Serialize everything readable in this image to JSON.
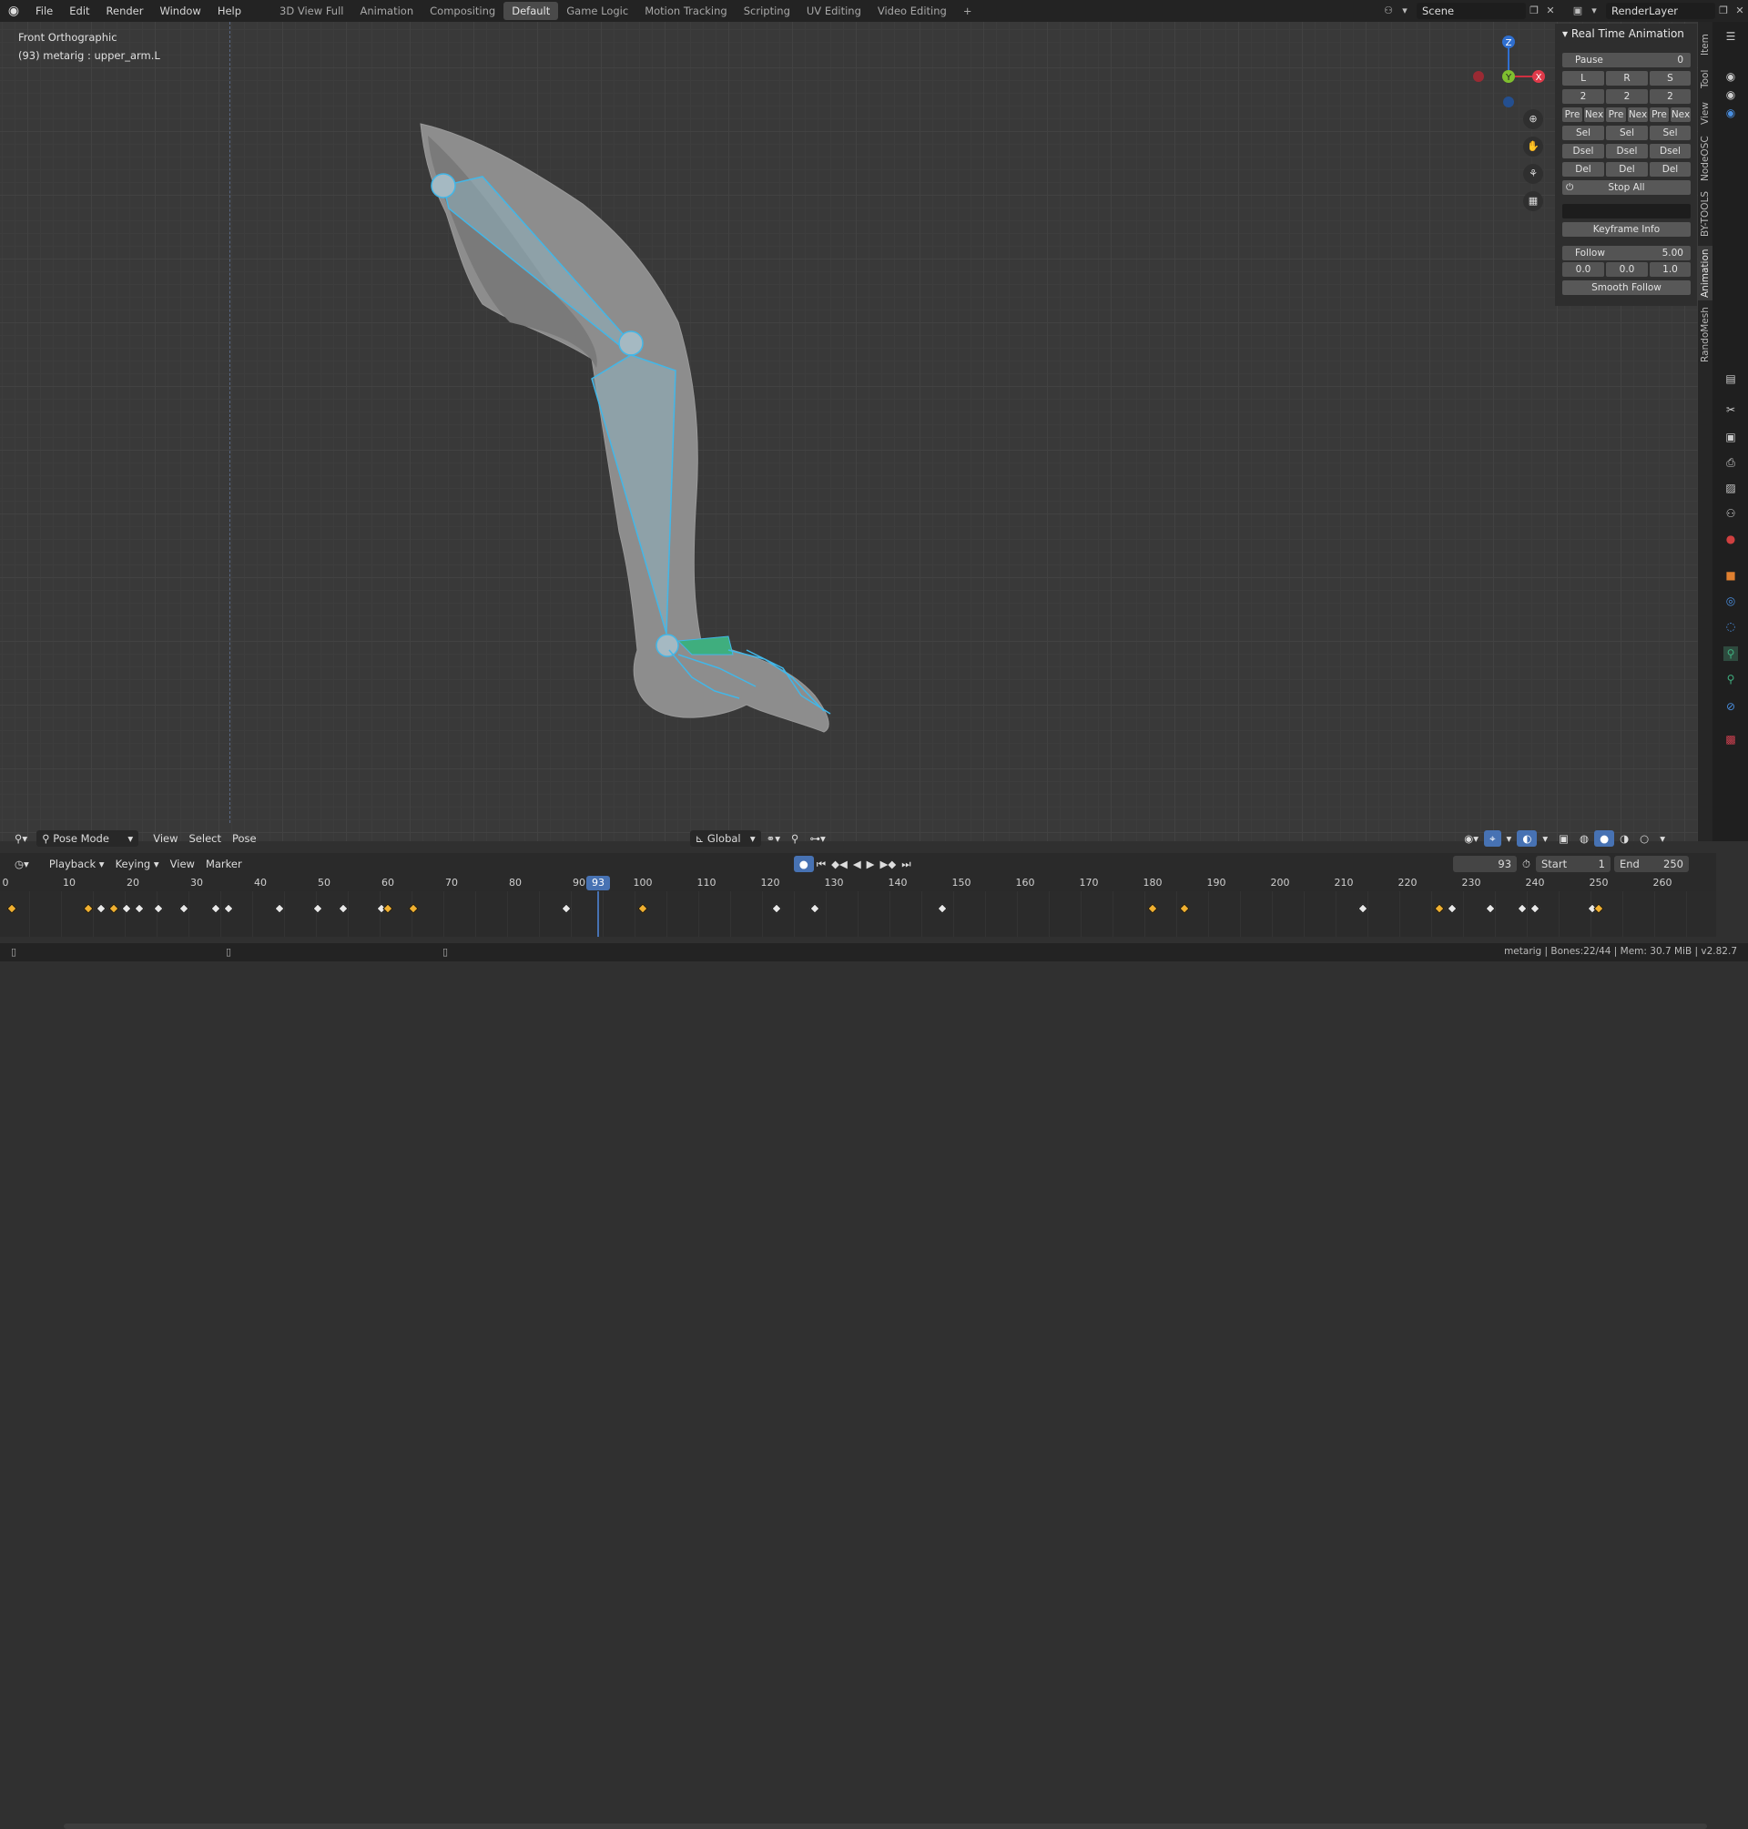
{
  "topbar": {
    "menus": [
      "File",
      "Edit",
      "Render",
      "Window",
      "Help"
    ],
    "workspaces": [
      "3D View Full",
      "Animation",
      "Compositing",
      "Default",
      "Game Logic",
      "Motion Tracking",
      "Scripting",
      "UV Editing",
      "Video Editing"
    ],
    "active_workspace": "Default",
    "add_tab": "+",
    "scene": "Scene",
    "render_layer": "RenderLayer"
  },
  "viewport": {
    "view_name": "Front Orthographic",
    "object_info": "(93) metarig : upper_arm.L",
    "gizmo": {
      "z": "Z",
      "y": "Y",
      "x": "X"
    }
  },
  "npanel": {
    "title": "Real Time Animation",
    "pause_label": "Pause",
    "pause_value": "0",
    "lrs": [
      "L",
      "R",
      "S"
    ],
    "counts": [
      "2",
      "2",
      "2"
    ],
    "prenex": [
      "Pre",
      "Nex",
      "Pre",
      "Nex",
      "Pre",
      "Nex"
    ],
    "sel": [
      "Sel",
      "Sel",
      "Sel"
    ],
    "dsel": [
      "Dsel",
      "Dsel",
      "Dsel"
    ],
    "del": [
      "Del",
      "Del",
      "Del"
    ],
    "stop_all": "Stop All",
    "keyframe_info": "Keyframe Info",
    "follow_label": "Follow",
    "follow_value": "5.00",
    "vec": [
      "0.0",
      "0.0",
      "1.0"
    ],
    "smooth_follow": "Smooth Follow"
  },
  "sidetabs": [
    "Item",
    "Tool",
    "View",
    "NodeOSC",
    "BY-TOOLS",
    "Animation",
    "RandoMesh"
  ],
  "vp_header": {
    "mode": "Pose Mode",
    "menus": [
      "View",
      "Select",
      "Pose"
    ],
    "orientation": "Global"
  },
  "timeline": {
    "menus": [
      "Playback",
      "Keying",
      "View",
      "Marker"
    ],
    "current_frame": "93",
    "start_label": "Start",
    "start_value": "1",
    "end_label": "End",
    "end_value": "250",
    "ticks": [
      "0",
      "10",
      "20",
      "30",
      "40",
      "50",
      "60",
      "70",
      "80",
      "90",
      "100",
      "110",
      "120",
      "130",
      "140",
      "150",
      "160",
      "170",
      "180",
      "190",
      "200",
      "210",
      "220",
      "230",
      "240",
      "250",
      "260"
    ],
    "current_marker": "93",
    "keyframes": [
      {
        "f": 1,
        "c": "yellow"
      },
      {
        "f": 13,
        "c": "yellow"
      },
      {
        "f": 15,
        "c": "white"
      },
      {
        "f": 17,
        "c": "yellow"
      },
      {
        "f": 19,
        "c": "white"
      },
      {
        "f": 21,
        "c": "white"
      },
      {
        "f": 24,
        "c": "white"
      },
      {
        "f": 28,
        "c": "white"
      },
      {
        "f": 33,
        "c": "white"
      },
      {
        "f": 35,
        "c": "white"
      },
      {
        "f": 43,
        "c": "white"
      },
      {
        "f": 49,
        "c": "white"
      },
      {
        "f": 53,
        "c": "white"
      },
      {
        "f": 59,
        "c": "white"
      },
      {
        "f": 60,
        "c": "yellow"
      },
      {
        "f": 64,
        "c": "yellow"
      },
      {
        "f": 88,
        "c": "white"
      },
      {
        "f": 100,
        "c": "yellow"
      },
      {
        "f": 121,
        "c": "white"
      },
      {
        "f": 127,
        "c": "white"
      },
      {
        "f": 147,
        "c": "white"
      },
      {
        "f": 180,
        "c": "yellow"
      },
      {
        "f": 185,
        "c": "yellow"
      },
      {
        "f": 213,
        "c": "white"
      },
      {
        "f": 225,
        "c": "yellow"
      },
      {
        "f": 227,
        "c": "white"
      },
      {
        "f": 233,
        "c": "white"
      },
      {
        "f": 238,
        "c": "white"
      },
      {
        "f": 240,
        "c": "white"
      },
      {
        "f": 249,
        "c": "white"
      },
      {
        "f": 250,
        "c": "yellow"
      }
    ]
  },
  "statusbar": {
    "text": "metarig | Bones:22/44 | Mem: 30.7 MiB | v2.82.7"
  }
}
